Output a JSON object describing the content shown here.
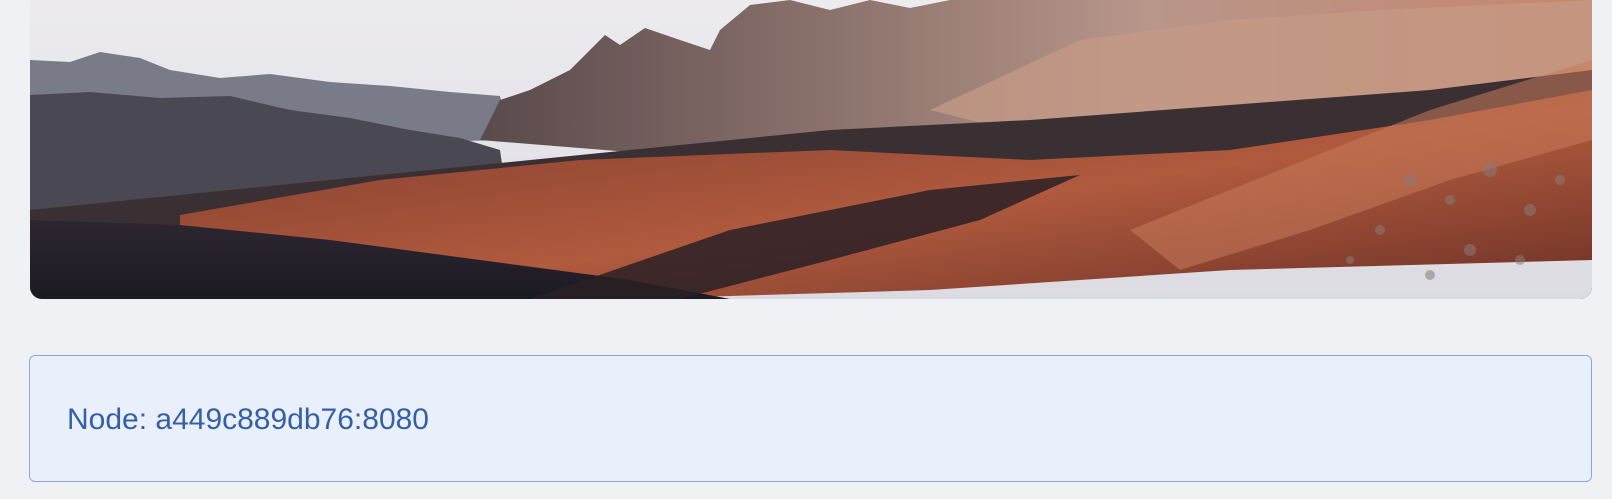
{
  "hero": {
    "image_name": "mountain-landscape-image",
    "colors": {
      "sky": "#e6e4ea",
      "far_ridge": "#6e6f7c",
      "mid_ridge": "#4c4a53",
      "rock_dark": "#3a2f33",
      "slope_rust": "#a0503a",
      "slope_light": "#c57a5f",
      "foreground": "#1f1c24"
    }
  },
  "node_info": {
    "label": "Node: a449c889db76:8080",
    "colors": {
      "text": "#3560a8",
      "border": "#8aa8de",
      "background": "#eaf0fb"
    }
  }
}
